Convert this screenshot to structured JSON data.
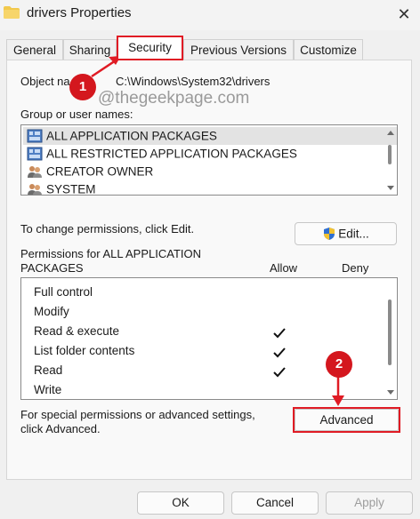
{
  "window": {
    "title": "drivers Properties",
    "close_glyph": "✕",
    "title_icon": "folder-icon"
  },
  "tabs": [
    {
      "label": "General",
      "active": false
    },
    {
      "label": "Sharing",
      "active": false
    },
    {
      "label": "Security",
      "active": true
    },
    {
      "label": "Previous Versions",
      "active": false
    },
    {
      "label": "Customize",
      "active": false
    }
  ],
  "security": {
    "object_name_label": "Object na",
    "object_name_value": "C:\\Windows\\System32\\drivers",
    "watermark": "@thegeekpage.com",
    "group_label": "Group or user names:",
    "groups": [
      {
        "name": "ALL APPLICATION PACKAGES",
        "icon": "app-package-icon",
        "selected": true
      },
      {
        "name": "ALL RESTRICTED APPLICATION PACKAGES",
        "icon": "app-package-icon",
        "selected": false
      },
      {
        "name": "CREATOR OWNER",
        "icon": "users-icon",
        "selected": false
      },
      {
        "name": "SYSTEM",
        "icon": "users-icon",
        "selected": false
      }
    ],
    "change_hint": "To change permissions, click Edit.",
    "edit_label": "Edit...",
    "permissions_for_line1": "Permissions for ALL APPLICATION",
    "permissions_for_line2": "PACKAGES",
    "allow_header": "Allow",
    "deny_header": "Deny",
    "permissions": [
      {
        "name": "Full control",
        "allow": false,
        "deny": false
      },
      {
        "name": "Modify",
        "allow": false,
        "deny": false
      },
      {
        "name": "Read & execute",
        "allow": true,
        "deny": false
      },
      {
        "name": "List folder contents",
        "allow": true,
        "deny": false
      },
      {
        "name": "Read",
        "allow": true,
        "deny": false
      },
      {
        "name": "Write",
        "allow": false,
        "deny": false
      }
    ],
    "advanced_hint_line1": "For special permissions or advanced settings,",
    "advanced_hint_line2": "click Advanced.",
    "advanced_label": "Advanced"
  },
  "footer": {
    "ok_label": "OK",
    "cancel_label": "Cancel",
    "apply_label": "Apply"
  },
  "annotations": {
    "step1": "1",
    "step2": "2",
    "highlight_color": "#e01b24"
  }
}
